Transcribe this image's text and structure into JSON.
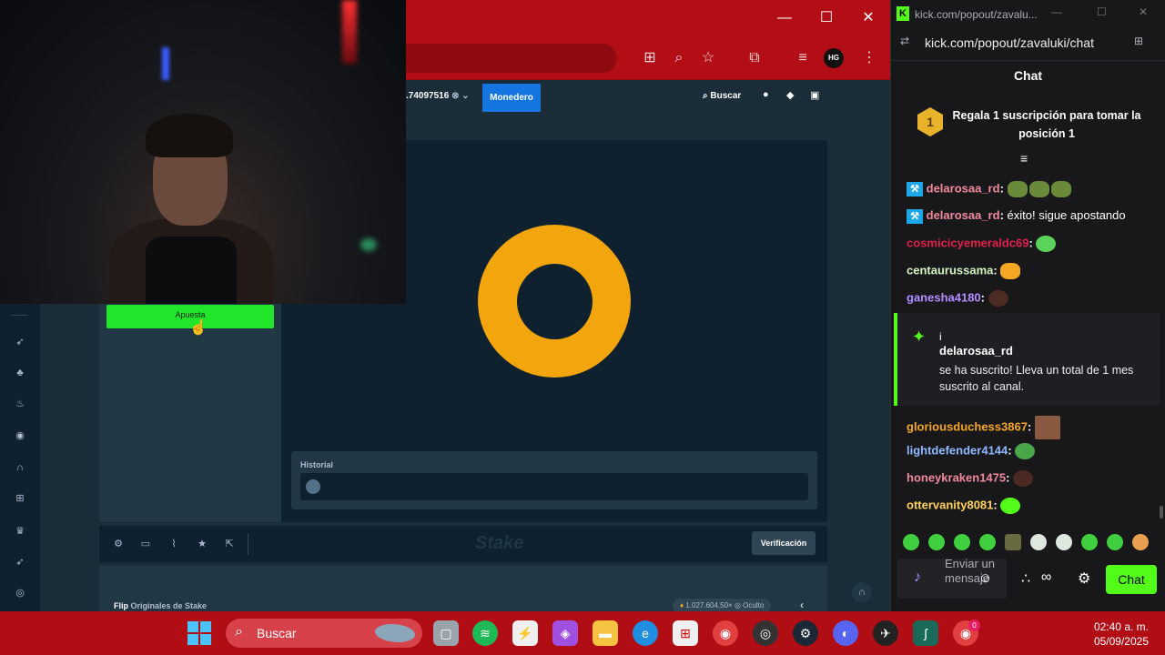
{
  "browser": {
    "url_left": "",
    "balance": "74097516",
    "wallet_label": "Monedero",
    "search_label": "Buscar",
    "extension_badge": "HG",
    "minimize": "—",
    "maximize": "☐",
    "close": "✕"
  },
  "stake": {
    "bet_button_label": "Apuesta",
    "history_label": "Historial",
    "verification_label": "Verificación",
    "game_name": "Flip",
    "game_category": "Originales de Stake",
    "game_stat": "1.027.604,50×",
    "game_hidden_label": "Oculto",
    "watermark": "Stake"
  },
  "kick": {
    "window_title": "kick.com/popout/zavalu...",
    "url": "kick.com/popout/zavaluki/chat",
    "chat_title": "Chat",
    "gift_rank": "1",
    "gift_text": "Regala 1 suscripción para tomar la posición 1",
    "messages": [
      {
        "user": "delarosaa_rd",
        "text": "",
        "color": "#f08a9a"
      },
      {
        "user": "delarosaa_rd",
        "text": "éxito! sigue apostando",
        "color": "#f08a9a"
      },
      {
        "user": "cosmicicyemeraldc69",
        "text": "",
        "color": "#e0204a"
      },
      {
        "user": "centaurussama",
        "text": "",
        "color": "#d4f5c0"
      },
      {
        "user": "ganesha4180",
        "text": "",
        "color": "#b38cff"
      }
    ],
    "sub_notice": {
      "prefix": "i",
      "user": "delarosaa_rd",
      "text": "se ha suscrito! Lleva un total de 1 mes suscrito al canal."
    },
    "messages2": [
      {
        "user": "gloriousduchess3867",
        "color": "#f5a623"
      },
      {
        "user": "lightdefender4144",
        "color": "#8fb8ff"
      },
      {
        "user": "honeykraken1475",
        "color": "#f08a9a"
      },
      {
        "user": "ottervanity8081",
        "color": "#ffd35c"
      }
    ],
    "input_placeholder": "Enviar un mensaje",
    "send_label": "Chat"
  },
  "taskbar": {
    "search_placeholder": "Buscar",
    "time": "02:40 a. m.",
    "date": "05/09/2025",
    "chrome_badge": "0"
  },
  "colors": {
    "bet_green": "#21e52a",
    "coin": "#f3a50e",
    "kick_green": "#53fc18",
    "wallet_blue": "#1475e1",
    "taskbar_red": "#b00d14"
  }
}
